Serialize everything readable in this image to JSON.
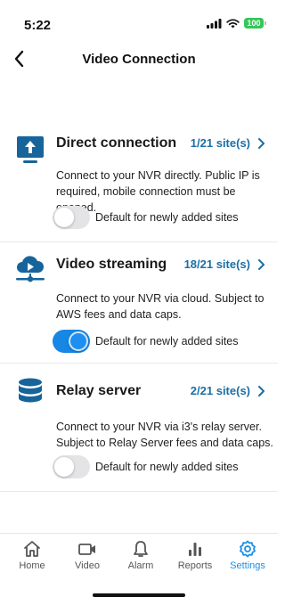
{
  "status_bar": {
    "time": "5:22",
    "battery": "100"
  },
  "header": {
    "title": "Video Connection"
  },
  "sections": [
    {
      "title": "Direct connection",
      "sites": "1/21 site(s)",
      "description": "Connect to your NVR directly. Public IP is required, mobile connection must be opened.",
      "toggle_label": "Default for newly added sites",
      "toggle_on": false,
      "icon": "upload-monitor-icon"
    },
    {
      "title": "Video streaming",
      "sites": "18/21 site(s)",
      "description": "Connect to your NVR via cloud. Subject to AWS fees and data caps.",
      "toggle_label": "Default for newly added sites",
      "toggle_on": true,
      "icon": "cloud-play-icon"
    },
    {
      "title": "Relay server",
      "sites": "2/21 site(s)",
      "description": "Connect to your NVR via i3's relay server. Subject to Relay Server fees and data caps.",
      "toggle_label": "Default for newly added sites",
      "toggle_on": false,
      "icon": "database-icon"
    }
  ],
  "tab_bar": {
    "tabs": [
      {
        "label": "Home",
        "icon": "home-icon"
      },
      {
        "label": "Video",
        "icon": "video-camera-icon"
      },
      {
        "label": "Alarm",
        "icon": "bell-icon"
      },
      {
        "label": "Reports",
        "icon": "bar-chart-icon"
      },
      {
        "label": "Settings",
        "icon": "gear-icon"
      }
    ],
    "active": "Settings"
  },
  "colors": {
    "accent": "#1b6fa6",
    "toggle_on": "#1787e6",
    "active_tab": "#1b8fe6",
    "icon_blue": "#17649b"
  }
}
